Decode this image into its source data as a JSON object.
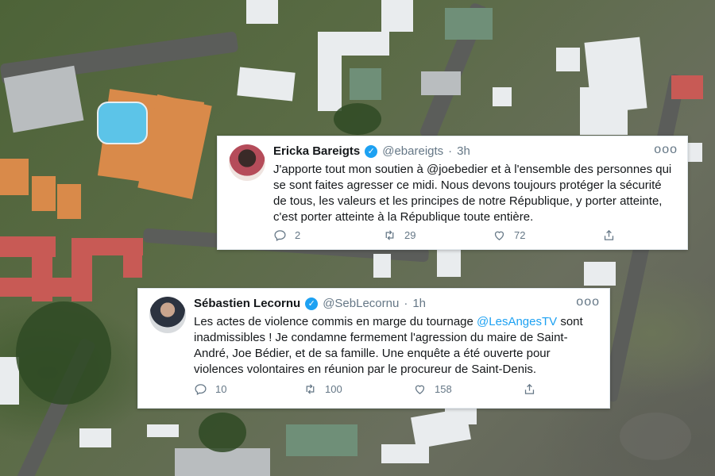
{
  "tweets": [
    {
      "author": "Ericka Bareigts",
      "handle": "@ebareigts",
      "separator": "·",
      "time": "3h",
      "text_parts": [
        {
          "text": "J'apporte tout mon soutien à @joebedier et à l'ensemble des personnes qui se sont faites  agresser ce midi. Nous devons toujours protéger la sécurité de tous, les valeurs et les principes de notre République, y porter atteinte, c'est porter atteinte à la République toute entière.",
          "link": false
        }
      ],
      "replies": "2",
      "retweets": "29",
      "likes": "72"
    },
    {
      "author": "Sébastien Lecornu",
      "handle": "@SebLecornu",
      "separator": "·",
      "time": "1h",
      "text_parts": [
        {
          "text": "Les actes de violence commis en marge du tournage ",
          "link": false
        },
        {
          "text": "@LesAngesTV",
          "link": true
        },
        {
          "text": " sont inadmissibles ! Je condamne fermement l'agression du maire de Saint-André, Joe Bédier, et de sa famille. Une enquête a été ouverte pour violences volontaires en réunion par le procureur de Saint-Denis.",
          "link": false
        }
      ],
      "replies": "10",
      "retweets": "100",
      "likes": "158"
    }
  ],
  "ui": {
    "more_glyph": "ooo",
    "verified_glyph": "✓"
  },
  "colors": {
    "accent": "#1da1f2",
    "text": "#14171a",
    "muted": "#657786"
  }
}
